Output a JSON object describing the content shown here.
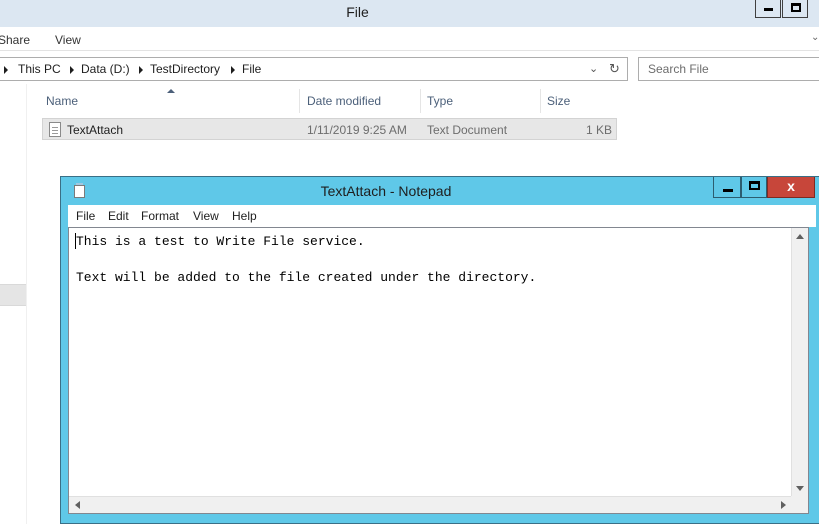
{
  "explorer": {
    "title": "File",
    "ribbon_tabs": [
      "Share",
      "View"
    ],
    "breadcrumb": [
      "This PC",
      "Data (D:)",
      "TestDirectory",
      "File"
    ],
    "search_placeholder": "Search File",
    "columns": [
      "Name",
      "Date modified",
      "Type",
      "Size"
    ],
    "files": [
      {
        "name": "TextAttach",
        "date_modified": "1/11/2019 9:25 AM",
        "type": "Text Document",
        "size": "1 KB"
      }
    ],
    "icons": [
      "minimize-icon",
      "maximize-icon",
      "chevron-down-icon",
      "refresh-icon",
      "text-file-icon",
      "sort-ascending-icon"
    ]
  },
  "notepad": {
    "title": "TextAttach - Notepad",
    "close_label": "x",
    "menu": [
      "File",
      "Edit",
      "Format",
      "View",
      "Help"
    ],
    "text_lines": [
      "This is a test to Write File service.",
      "",
      "Text will be added to the file created under the directory."
    ],
    "title_bar_color": "#5fc8e8",
    "close_button_color": "#c7463a"
  }
}
